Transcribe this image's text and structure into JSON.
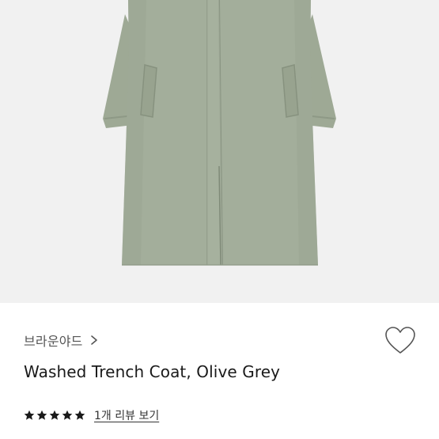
{
  "product": {
    "image_icon": "olive-grey-trench-coat-photo",
    "image_bg_color": "#f1f1f1",
    "coat_color": "#a3ae9b",
    "brand": "브라운야드",
    "brand_chevron_icon": "chevron-right-icon",
    "title": "Washed Trench Coat, Olive Grey",
    "wishlist_icon": "heart-outline-icon",
    "rating": {
      "value": 5,
      "max": 5,
      "star_icon": "star-filled-icon",
      "star_color": "#1a1a1a"
    },
    "review_link": "1개 리뷰 보기"
  }
}
